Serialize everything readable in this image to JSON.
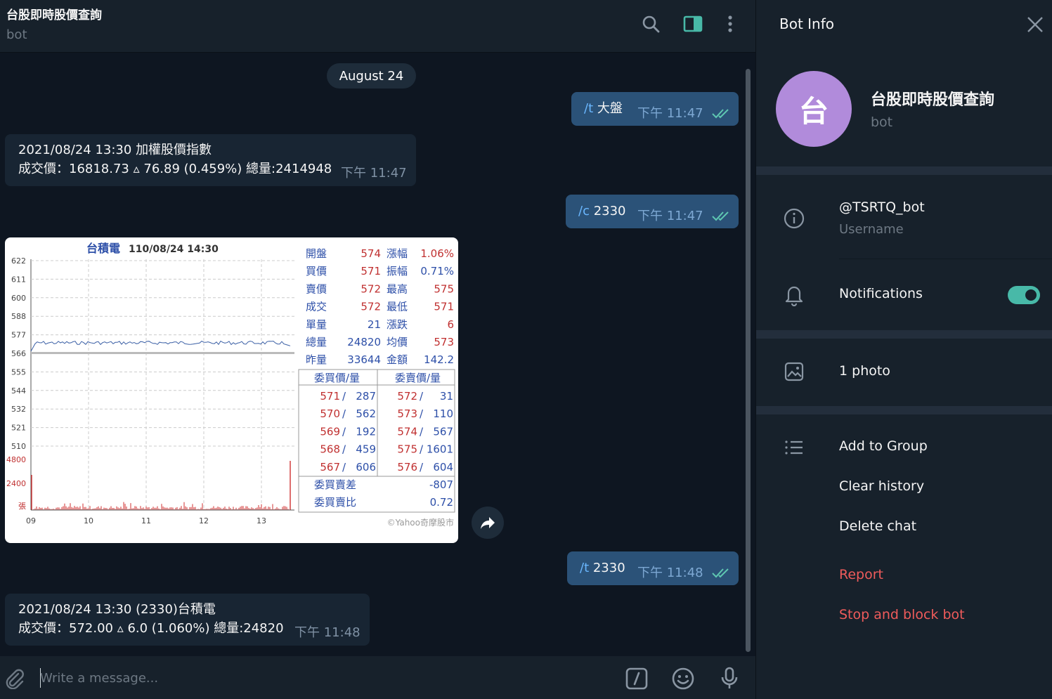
{
  "chat": {
    "title": "台股即時股價查詢",
    "subtitle": "bot",
    "date_pill": "August 24",
    "composer_placeholder": "Write a message..."
  },
  "messages": [
    {
      "dir": "out",
      "cmd": "/t",
      "text": " 大盤",
      "time": "下午 11:47"
    },
    {
      "dir": "in",
      "line1": "2021/08/24 13:30 加權股價指數",
      "line2": "成交價：16818.73 ▵  76.89 (0.459%) 總量:2414948",
      "time": "下午 11:47"
    },
    {
      "dir": "out",
      "cmd": "/c",
      "text": " 2330",
      "time": "下午 11:47"
    },
    {
      "dir": "out",
      "cmd": "/t",
      "text": " 2330",
      "time": "下午 11:48"
    },
    {
      "dir": "in",
      "line1": "2021/08/24 13:30 (2330)台積電",
      "line2": "成交價：572.00 ▵  6.0 (1.060%) 總量:24820",
      "time": "下午 11:48"
    }
  ],
  "photo": {
    "title_name": "台積電",
    "title_time": "110/08/24 14:30",
    "y_labels": [
      "622",
      "611",
      "600",
      "588",
      "577",
      "566",
      "555",
      "544",
      "532",
      "521",
      "510"
    ],
    "vol_labels": [
      "4800",
      "2400",
      "張"
    ],
    "x_labels": [
      "09",
      "10",
      "11",
      "12",
      "13"
    ],
    "quote_rows": [
      {
        "k1": "開盤",
        "v1": "574",
        "k2": "漲幅",
        "v2": "1.06%"
      },
      {
        "k1": "買價",
        "v1": "571",
        "k2": "振幅",
        "v2": "0.71%"
      },
      {
        "k1": "賣價",
        "v1": "572",
        "k2": "最高",
        "v2": "575"
      },
      {
        "k1": "成交",
        "v1": "572",
        "k2": "最低",
        "v2": "571"
      },
      {
        "k1": "單量",
        "v1": "21",
        "k2": "漲跌",
        "v2": "6"
      },
      {
        "k1": "總量",
        "v1": "24820",
        "k2": "均價",
        "v2": "573"
      },
      {
        "k1": "昨量",
        "v1": "33644",
        "k2": "金額",
        "v2": "142.2"
      }
    ],
    "book_header": [
      "委買價/量",
      "委賣價/量"
    ],
    "book_rows": [
      {
        "bp": "571",
        "bq": "287",
        "ap": "572",
        "aq": "31"
      },
      {
        "bp": "570",
        "bq": "562",
        "ap": "573",
        "aq": "110"
      },
      {
        "bp": "569",
        "bq": "192",
        "ap": "574",
        "aq": "567"
      },
      {
        "bp": "568",
        "bq": "459",
        "ap": "575",
        "aq": "1601"
      },
      {
        "bp": "567",
        "bq": "606",
        "ap": "576",
        "aq": "604"
      }
    ],
    "diff_label": "委買賣差",
    "diff_value": "-807",
    "ratio_label": "委買賣比",
    "ratio_value": "0.72",
    "watermark": "©Yahoo奇摩股市"
  },
  "info": {
    "title": "Bot Info",
    "avatar_letter": "台",
    "name": "台股即時股價查詢",
    "role": "bot",
    "username": "@TSRTQ_bot",
    "username_label": "Username",
    "notifications": "Notifications",
    "notifications_on": true,
    "photos": "1 photo",
    "add_to_group": "Add to Group",
    "clear_history": "Clear history",
    "delete_chat": "Delete chat",
    "report": "Report",
    "stop_block": "Stop and block bot"
  },
  "colors": {
    "accent": "#48b9a8",
    "danger": "#ef5b5b",
    "avatar": "#b18bdb",
    "bg": "#0e1621",
    "panel": "#17212b"
  }
}
